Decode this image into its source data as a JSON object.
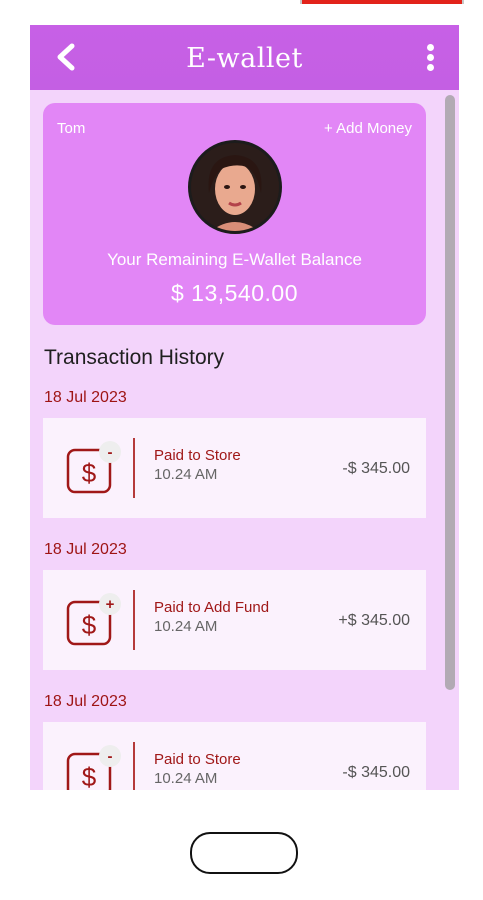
{
  "header": {
    "title": "E-wallet",
    "back_icon": "back-arrow-icon",
    "menu_icon": "more-vertical-icon"
  },
  "wallet": {
    "user_name": "Tom",
    "add_money_label": "+ Add Money",
    "balance_label": "Your Remaining E-Wallet Balance",
    "balance": "$ 13,540.00"
  },
  "history": {
    "title": "Transaction History",
    "items": [
      {
        "date": "18 Jul 2023",
        "sign": "-",
        "name": "Paid to Store",
        "time": "10.24 AM",
        "amount": "-$ 345.00"
      },
      {
        "date": "18 Jul 2023",
        "sign": "+",
        "name": "Paid to Add Fund",
        "time": "10.24 AM",
        "amount": "+$ 345.00"
      },
      {
        "date": "18 Jul 2023",
        "sign": "-",
        "name": "Paid to Store",
        "time": "10.24 AM",
        "amount": "-$ 345.00"
      }
    ]
  },
  "colors": {
    "appbar": "#c760e6",
    "card": "#e286f6",
    "background": "#f3d4fb",
    "accent_text": "#a01818"
  }
}
